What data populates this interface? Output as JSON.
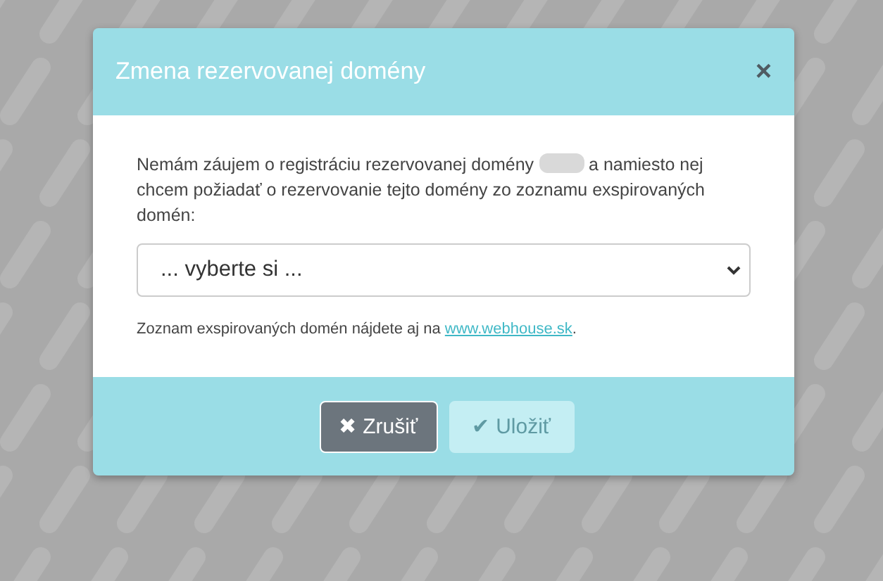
{
  "dialog": {
    "title": "Zmena rezervovanej domény",
    "close": "×"
  },
  "message": {
    "before": "Nemám záujem o registráciu rezervovanej domény",
    "after": "a namiesto nej chcem požiadať o rezervovanie tejto domény zo zoznamu exspirovaných domén:"
  },
  "select": {
    "value": "... vyberte si ..."
  },
  "note": {
    "text": "Zoznam exspirovaných domén nájdete aj na",
    "link": "www.webhouse.sk",
    "end": "."
  },
  "buttons": [
    {
      "kind": "cancel",
      "label": "Zrušiť",
      "icon": "✖",
      "disabled": false
    },
    {
      "kind": "save",
      "label": "Uložiť",
      "icon": "✔",
      "disabled": true
    }
  ]
}
